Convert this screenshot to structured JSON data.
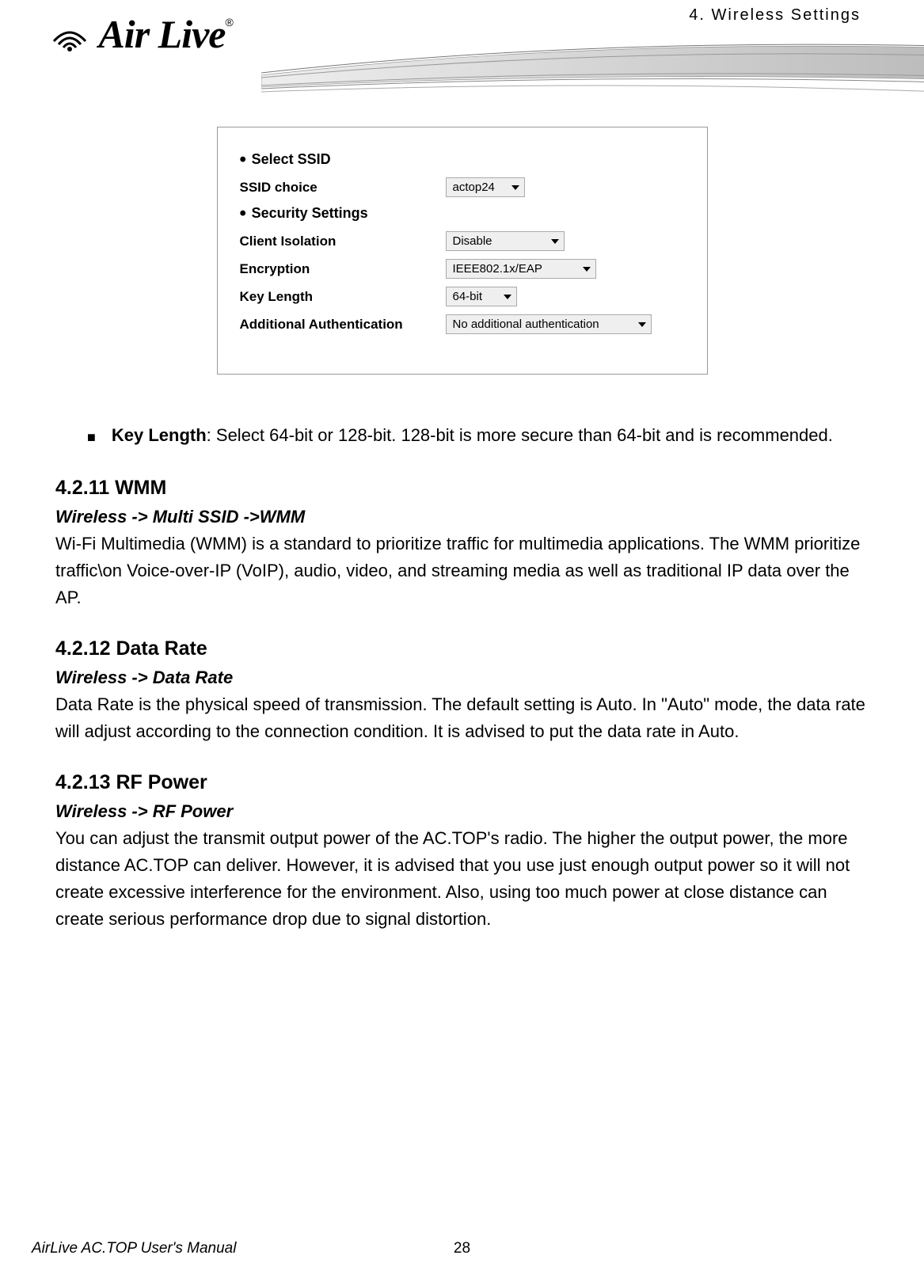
{
  "header": {
    "chapter": "4.  Wireless  Settings",
    "logo_text": "Air Live",
    "logo_reg": "®"
  },
  "screenshot": {
    "heading1": "Select SSID",
    "row_ssid_label": "SSID choice",
    "row_ssid_value": "actop24",
    "heading2": "Security Settings",
    "row_isolation_label": "Client Isolation",
    "row_isolation_value": "Disable",
    "row_encryption_label": "Encryption",
    "row_encryption_value": "IEEE802.1x/EAP",
    "row_keylength_label": "Key Length",
    "row_keylength_value": "64-bit",
    "row_auth_label": "Additional Authentication",
    "row_auth_value": "No additional authentication"
  },
  "bullet": {
    "term": "Key Length",
    "text": ": Select 64-bit or 128-bit. 128-bit is more secure than 64-bit and is recommended."
  },
  "sections": {
    "wmm": {
      "heading": "4.2.11 WMM",
      "path": "Wireless -> Multi SSID ->WMM",
      "body": "Wi-Fi Multimedia (WMM) is a standard to prioritize traffic for multimedia applications. The WMM prioritize traffic\\on Voice-over-IP (VoIP), audio, video, and streaming media as well as traditional IP data over the AP."
    },
    "datarate": {
      "heading": "4.2.12 Data Rate",
      "path": "Wireless -> Data Rate",
      "body": "Data Rate is the physical speed of transmission. The default setting is Auto. In \"Auto\" mode, the data rate will adjust according to the connection condition. It is advised to put the data rate in Auto."
    },
    "rfpower": {
      "heading": "4.2.13 RF Power",
      "path": "Wireless -> RF Power",
      "body": "You can adjust the transmit output power of the AC.TOP's radio. The higher the output power, the more distance AC.TOP can deliver. However, it is advised that you use just enough output power so it will not create excessive interference for the environment.    Also, using too much power at close distance can create serious performance drop due to signal distortion."
    }
  },
  "footer": {
    "manual": "AirLive AC.TOP User's Manual",
    "page": "28"
  }
}
